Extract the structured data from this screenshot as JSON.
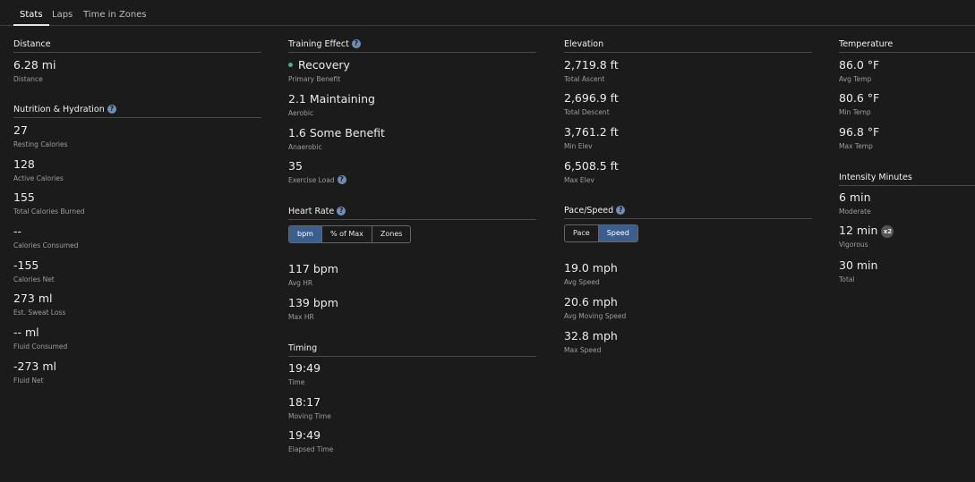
{
  "tabs": [
    "Stats",
    "Laps",
    "Time in Zones"
  ],
  "distance": {
    "title": "Distance",
    "stats": [
      {
        "value": "6.28 mi",
        "label": "Distance"
      }
    ]
  },
  "nutrition": {
    "title": "Nutrition & Hydration",
    "stats": [
      {
        "value": "27",
        "label": "Resting Calories"
      },
      {
        "value": "128",
        "label": "Active Calories"
      },
      {
        "value": "155",
        "label": "Total Calories Burned"
      },
      {
        "value": "--",
        "label": "Calories Consumed"
      },
      {
        "value": "-155",
        "label": "Calories Net"
      },
      {
        "value": "273 ml",
        "label": "Est. Sweat Loss"
      },
      {
        "value": "-- ml",
        "label": "Fluid Consumed"
      },
      {
        "value": "-273 ml",
        "label": "Fluid Net"
      }
    ]
  },
  "training": {
    "title": "Training Effect",
    "stats": [
      {
        "value": "Recovery",
        "label": "Primary Benefit"
      },
      {
        "value": "2.1 Maintaining",
        "label": "Aerobic"
      },
      {
        "value": "1.6 Some Benefit",
        "label": "Anaerobic"
      },
      {
        "value": "35",
        "label": "Exercise Load"
      }
    ],
    "dot_color": "#4caf80"
  },
  "heart_rate": {
    "title": "Heart Rate",
    "toggle": [
      "bpm",
      "% of Max",
      "Zones"
    ],
    "selected": "bpm",
    "stats": [
      {
        "value": "117 bpm",
        "label": "Avg HR"
      },
      {
        "value": "139 bpm",
        "label": "Max HR"
      }
    ]
  },
  "timing": {
    "title": "Timing",
    "stats": [
      {
        "value": "19:49",
        "label": "Time"
      },
      {
        "value": "18:17",
        "label": "Moving Time"
      },
      {
        "value": "19:49",
        "label": "Elapsed Time"
      }
    ]
  },
  "elevation": {
    "title": "Elevation",
    "stats": [
      {
        "value": "2,719.8 ft",
        "label": "Total Ascent"
      },
      {
        "value": "2,696.9 ft",
        "label": "Total Descent"
      },
      {
        "value": "3,761.2 ft",
        "label": "Min Elev"
      },
      {
        "value": "6,508.5 ft",
        "label": "Max Elev"
      }
    ]
  },
  "pace_speed": {
    "title": "Pace/Speed",
    "toggle": [
      "Pace",
      "Speed"
    ],
    "selected": "Speed",
    "stats": [
      {
        "value": "19.0 mph",
        "label": "Avg Speed"
      },
      {
        "value": "20.6 mph",
        "label": "Avg Moving Speed"
      },
      {
        "value": "32.8 mph",
        "label": "Max Speed"
      }
    ]
  },
  "temperature": {
    "title": "Temperature",
    "stats": [
      {
        "value": "86.0 °F",
        "label": "Avg Temp"
      },
      {
        "value": "80.6 °F",
        "label": "Min Temp"
      },
      {
        "value": "96.8 °F",
        "label": "Max Temp"
      }
    ]
  },
  "intensity": {
    "title": "Intensity Minutes",
    "stats": [
      {
        "value": "6 min",
        "label": "Moderate"
      },
      {
        "value": "12 min",
        "label": "Vigorous",
        "badge": "x2"
      },
      {
        "value": "30 min",
        "label": "Total"
      }
    ]
  },
  "colors": {
    "background": "#1b1b1b",
    "accent": "#3a5f8f",
    "help_icon": "#6f8fb8"
  }
}
